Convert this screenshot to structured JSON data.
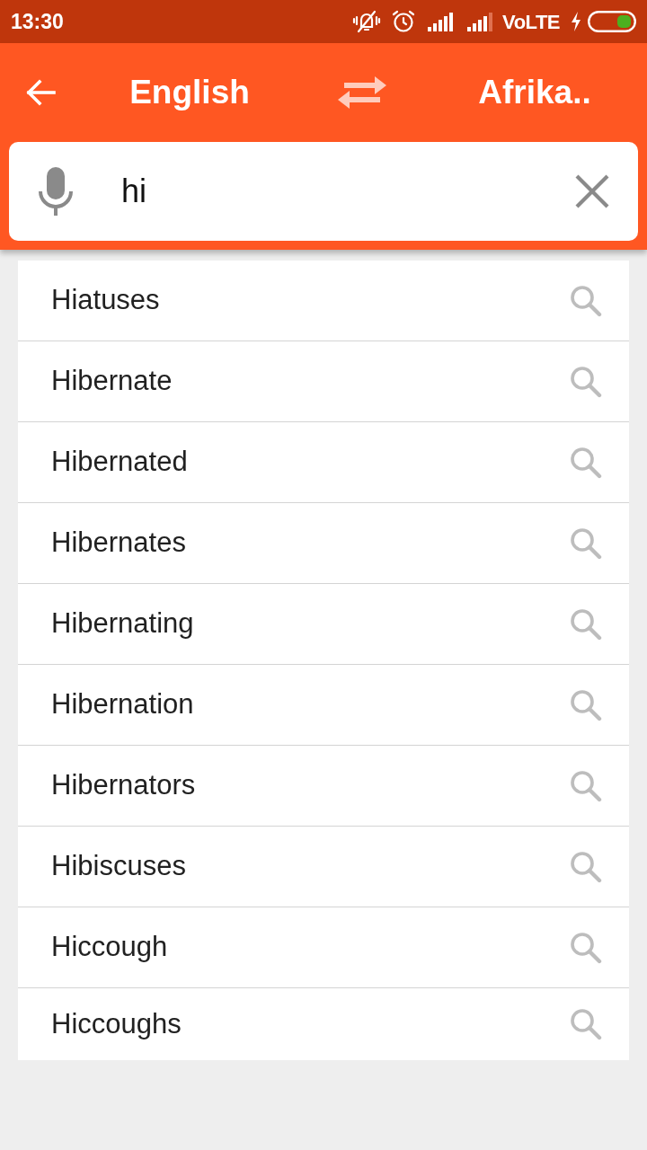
{
  "status_bar": {
    "time": "13:30",
    "network": "VoLTE"
  },
  "toolbar": {
    "source_language": "English",
    "target_language": "Afrika.."
  },
  "search": {
    "value": "hi"
  },
  "suggestions": [
    "Hiatuses",
    "Hibernate",
    "Hibernated",
    "Hibernates",
    "Hibernating",
    "Hibernation",
    "Hibernators",
    "Hibiscuses",
    "Hiccough",
    "Hiccoughs"
  ]
}
